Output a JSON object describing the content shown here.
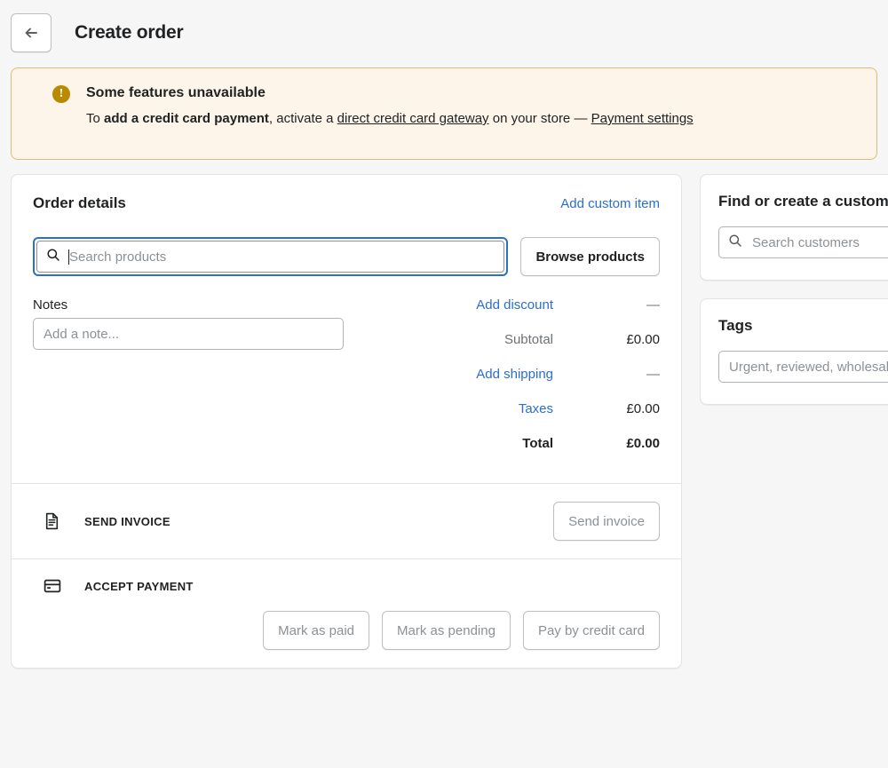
{
  "header": {
    "back_icon": "arrow-left-icon",
    "title": "Create order"
  },
  "banner": {
    "icon": "alert-circle-icon",
    "icon_glyph": "!",
    "title": "Some features unavailable",
    "text_prefix": "To ",
    "text_bold": "add a credit card payment",
    "text_middle": ", activate a ",
    "link_gateway": "direct credit card gateway",
    "text_after": " on your store — ",
    "link_settings": "Payment settings",
    "accent_color": "#b98900",
    "background_color": "#fdf5ea",
    "border_color": "#e1b878"
  },
  "order_details": {
    "title": "Order details",
    "add_custom_item": "Add custom item",
    "search": {
      "icon": "search-icon",
      "placeholder": "Search products",
      "value": "",
      "focused": true
    },
    "browse_button": "Browse products",
    "notes": {
      "label": "Notes",
      "placeholder": "Add a note...",
      "value": ""
    },
    "totals": [
      {
        "label": "Add discount",
        "value": "—",
        "link": true,
        "strong": false
      },
      {
        "label": "Subtotal",
        "value": "£0.00",
        "link": false,
        "strong": false
      },
      {
        "label": "Add shipping",
        "value": "—",
        "link": true,
        "strong": false
      },
      {
        "label": "Taxes",
        "value": "£0.00",
        "link": true,
        "strong": false
      },
      {
        "label": "Total",
        "value": "£0.00",
        "link": false,
        "strong": true
      }
    ],
    "send_invoice": {
      "icon": "document-icon",
      "title": "SEND INVOICE",
      "button": "Send invoice"
    },
    "accept_payment": {
      "icon": "credit-card-icon",
      "title": "ACCEPT PAYMENT",
      "buttons": [
        "Mark as paid",
        "Mark as pending",
        "Pay by credit card"
      ]
    }
  },
  "sidebar": {
    "customer_card": {
      "title": "Find or create a customer",
      "search": {
        "icon": "search-icon",
        "placeholder": "Search customers",
        "value": ""
      }
    },
    "tags_card": {
      "title": "Tags",
      "input": {
        "placeholder": "Urgent, reviewed, wholesale",
        "value": ""
      }
    }
  },
  "colors": {
    "link": "#2c6ecb",
    "page_background": "#f6f6f7",
    "text": "#202223",
    "muted_text": "#6d7175"
  }
}
